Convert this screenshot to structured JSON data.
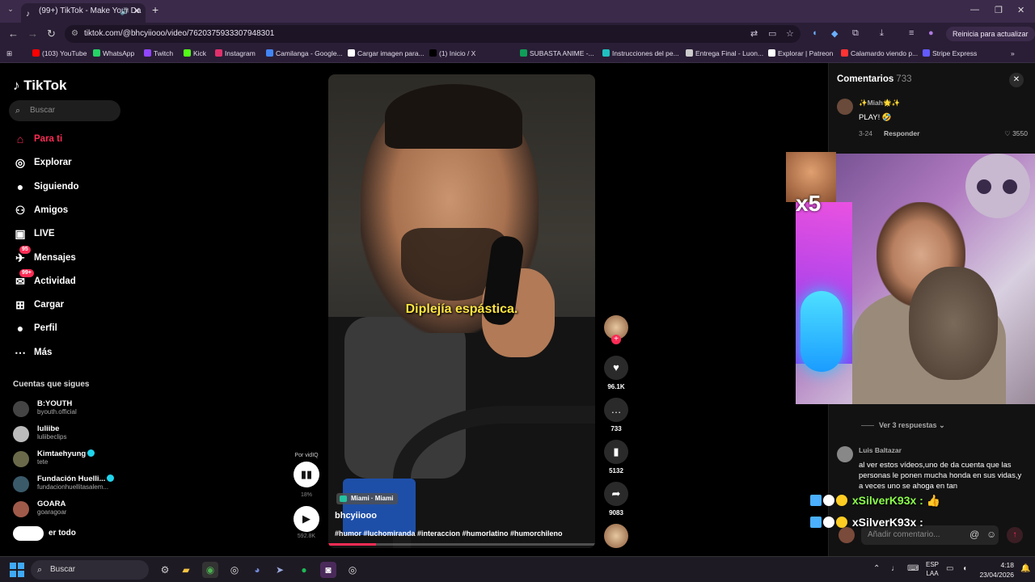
{
  "browser": {
    "tab_title": "(99+) TikTok - Make Your Da",
    "url": "tiktok.com/@bhcyiiooo/video/7620375933307948301",
    "update_label": "Reinicia para actualizar",
    "bookmarks": [
      {
        "label": "(103) YouTube",
        "color": "#ff0000"
      },
      {
        "label": "WhatsApp",
        "color": "#25d366"
      },
      {
        "label": "Twitch",
        "color": "#9146ff"
      },
      {
        "label": "Kick",
        "color": "#53fc18"
      },
      {
        "label": "Instagram",
        "color": "#e1306c"
      },
      {
        "label": "Camilanga - Google...",
        "color": "#4285f4"
      },
      {
        "label": "Cargar imagen para...",
        "color": "#ffffff"
      },
      {
        "label": "(1) Inicio / X",
        "color": "#000000"
      },
      {
        "label": "SUBASTA ANIME -...",
        "color": "#0f9d58"
      },
      {
        "label": "Instrucciones del pe...",
        "color": "#20c0c0"
      },
      {
        "label": "Entrega Final - Luon...",
        "color": "#cccccc"
      },
      {
        "label": "Explorar | Patreon",
        "color": "#ffffff"
      },
      {
        "label": "Calamardo viendo p...",
        "color": "#ff3333"
      },
      {
        "label": "Stripe Express",
        "color": "#635bff"
      }
    ]
  },
  "sidebar": {
    "logo": "TikTok",
    "search_placeholder": "Buscar",
    "nav": [
      {
        "label": "Para ti",
        "icon": "home-icon",
        "active": true
      },
      {
        "label": "Explorar",
        "icon": "compass-icon"
      },
      {
        "label": "Siguiendo",
        "icon": "following-avatar-icon"
      },
      {
        "label": "Amigos",
        "icon": "friends-icon"
      },
      {
        "label": "LIVE",
        "icon": "live-icon"
      },
      {
        "label": "Mensajes",
        "icon": "messages-icon",
        "badge": "95"
      },
      {
        "label": "Actividad",
        "icon": "activity-icon",
        "badge": "99+"
      },
      {
        "label": "Cargar",
        "icon": "upload-icon"
      },
      {
        "label": "Perfil",
        "icon": "profile-avatar-icon"
      },
      {
        "label": "Más",
        "icon": "more-icon"
      }
    ],
    "following_title": "Cuentas que sigues",
    "accounts": [
      {
        "name": "B:YOUTH",
        "handle": "byouth.official"
      },
      {
        "name": "luliibe",
        "handle": "luliibeclips"
      },
      {
        "name": "Kimtaehyung",
        "handle": "tete",
        "verified": true
      },
      {
        "name": "Fundación Huelli...",
        "handle": "fundacionhuellitasalem...",
        "verified": true
      },
      {
        "name": "GOARA",
        "handle": "goaragoar"
      }
    ],
    "see_all": "er todo"
  },
  "video": {
    "subtitle": "Diplejía espástica.",
    "location": "Miami · Miami",
    "author": "bhcyiiooo",
    "tags": "#humor #luchomiranda #interaccion #humorlatino #humorchileno",
    "progress": 0.18
  },
  "actions": {
    "likes": "96.1K",
    "comments": "733",
    "saves": "5132",
    "shares": "9083"
  },
  "vidiq": {
    "label": "Por vidIQ",
    "percent": "18%",
    "views": "592.8K"
  },
  "comments_panel": {
    "title": "Comentarios",
    "count": "733",
    "items": [
      {
        "user": "✨Miah🌟✨",
        "text": "PLAY! 🤣",
        "date": "3-24",
        "reply": "Responder",
        "likes": "3550"
      },
      {
        "user": "Luis Baltazar",
        "text": "al ver estos vídeos,uno de da cuenta que las personas le ponen mucha honda en sus vidas,y a veces uno se ahoga en tan",
        "date": "",
        "reply": "",
        "likes": ""
      }
    ],
    "replies_label": "Ver 3 respuestas",
    "input_placeholder": "Añadir comentario..."
  },
  "overlay": {
    "multiplier": "x5",
    "chat": [
      {
        "name": "xSilverK93x :",
        "extra": "👍"
      },
      {
        "name": "xSilverK93x :",
        "extra": ""
      }
    ]
  },
  "taskbar": {
    "search": "Buscar",
    "lang1": "ESP",
    "lang2": "LAA",
    "time": "4:18",
    "date": "23/04/2026"
  }
}
